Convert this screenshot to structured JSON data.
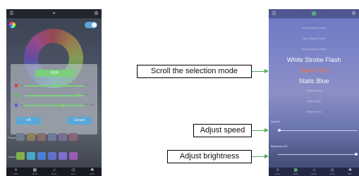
{
  "left_phone": {
    "dialog_title": "RGB",
    "sliders": [
      {
        "color": "#d64545",
        "value_label": "",
        "knob_fraction": 0.55
      },
      {
        "color": "#5bbf5b",
        "value_label": "",
        "knob_fraction": 0.9
      },
      {
        "color": "#4a66d6",
        "value_label": "255",
        "knob_fraction": 0.65
      }
    ],
    "ok_label": "OK",
    "cancel_label": "Cancel",
    "preset_label": "Preset",
    "custom_label": "Custom",
    "preset_colors": [
      "#6f7d8a",
      "#8e7f62",
      "#8a6d6d",
      "#6b7a9a",
      "#7a6f92",
      "#8b6478"
    ],
    "custom_colors": [
      "#7fb24a",
      "#4aa6c8",
      "#4a7ed6",
      "#5e70cc",
      "#7c6fd0",
      "#9a5ab8"
    ]
  },
  "right_phone": {
    "modes": [
      "Yellow Strobe Flash",
      "Cyan Strobe Flash",
      "Purple Strobe Flash",
      "White Strobe Flash",
      "Static Red",
      "Static Blue",
      "Static Green",
      "Static Cyan",
      "Static Yellow"
    ],
    "selected_mode_index": 4,
    "speed_label": "Speed:0",
    "speed_fraction": 0.0,
    "brightness_label": "Brightness:100",
    "brightness_fraction": 1.0
  },
  "nav_items": [
    {
      "icon": "sliders-icon",
      "label": "Color"
    },
    {
      "icon": "grid-icon",
      "label": "Mode"
    },
    {
      "icon": "music-icon",
      "label": "Music"
    },
    {
      "icon": "timer-icon",
      "label": "Timer"
    },
    {
      "icon": "settings-icon",
      "label": "More"
    }
  ],
  "callouts": {
    "scroll": "Scroll the selection mode",
    "speed": "Adjust speed",
    "brightness": "Adjust brightness"
  },
  "colors": {
    "accent_green": "#4caf50",
    "selected_mode_red": "#f07050"
  }
}
